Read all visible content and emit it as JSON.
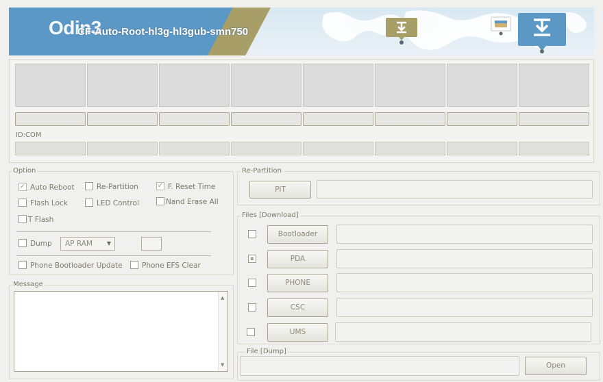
{
  "banner": {
    "app_name": "Odin3",
    "subtitle": "CF-Auto-Root-hl3g-hl3gub-smn750"
  },
  "status": {
    "idcom_label": "ID:COM",
    "slot_count": 8
  },
  "option": {
    "title": "Option",
    "auto_reboot": "Auto Reboot",
    "re_partition": "Re-Partition",
    "f_reset_time": "F. Reset Time",
    "flash_lock": "Flash Lock",
    "led_control": "LED Control",
    "nand_erase_all": "Nand Erase All",
    "t_flash": "T Flash",
    "dump": "Dump",
    "dump_select_value": "AP RAM",
    "phone_bootloader_update": "Phone Bootloader Update",
    "phone_efs_clear": "Phone EFS Clear",
    "checked": {
      "auto_reboot": true,
      "re_partition": false,
      "f_reset_time": true,
      "flash_lock": false,
      "led_control": false,
      "nand_erase_all": false,
      "t_flash": false,
      "dump": false,
      "phone_bootloader_update": false,
      "phone_efs_clear": false
    }
  },
  "message": {
    "title": "Message",
    "content": ""
  },
  "repartition": {
    "title": "Re-Partition",
    "pit_label": "PIT"
  },
  "files": {
    "title": "Files [Download]",
    "bootloader": "Bootloader",
    "pda": "PDA",
    "phone": "PHONE",
    "csc": "CSC",
    "ums": "UMS",
    "pda_checked": true
  },
  "file_dump": {
    "title": "File [Dump]",
    "open_label": "Open"
  },
  "colors": {
    "banner_blue": "#5c98c6",
    "banner_olive": "#a89e68",
    "accent_text": "#7a7a68"
  }
}
